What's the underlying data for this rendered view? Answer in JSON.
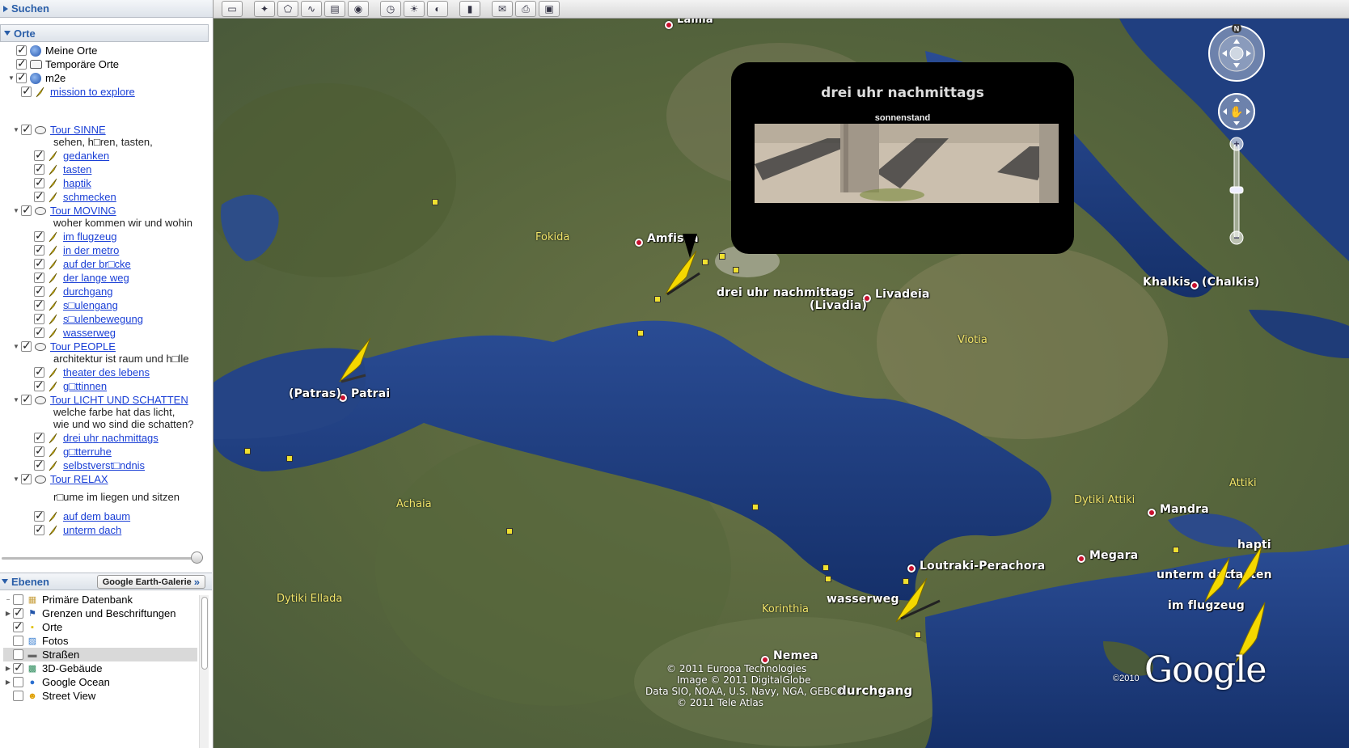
{
  "sidebar": {
    "search_header": "Suchen",
    "places_header": "Orte",
    "places": [
      {
        "label": "Meine Orte",
        "type": "globe",
        "level": 0,
        "link": false,
        "expander": ""
      },
      {
        "label": "Temporäre Orte",
        "type": "folder",
        "level": 0,
        "link": false,
        "expander": ""
      },
      {
        "label": "m2e",
        "type": "globe",
        "level": 0,
        "link": false,
        "expander": "▼"
      },
      {
        "label": "mission to explore",
        "type": "pin",
        "level": 1,
        "link": true,
        "expander": ""
      },
      {
        "label": "Tour SINNE",
        "type": "tour",
        "level": 1,
        "link": true,
        "expander": "▼"
      },
      {
        "label": "sehen, h□ren, tasten,",
        "type": "desc",
        "level": 1,
        "link": false,
        "expander": ""
      },
      {
        "label": "gedanken",
        "type": "pin",
        "level": 2,
        "link": true,
        "expander": ""
      },
      {
        "label": "tasten",
        "type": "pin",
        "level": 2,
        "link": true,
        "expander": ""
      },
      {
        "label": "haptik",
        "type": "pin",
        "level": 2,
        "link": true,
        "expander": ""
      },
      {
        "label": "schmecken",
        "type": "pin",
        "level": 2,
        "link": true,
        "expander": ""
      },
      {
        "label": "Tour MOVING",
        "type": "tour",
        "level": 1,
        "link": true,
        "expander": "▼"
      },
      {
        "label": "woher kommen wir und wohin",
        "type": "desc",
        "level": 1,
        "link": false,
        "expander": ""
      },
      {
        "label": "im flugzeug",
        "type": "pin",
        "level": 2,
        "link": true,
        "expander": ""
      },
      {
        "label": "in der metro",
        "type": "pin",
        "level": 2,
        "link": true,
        "expander": ""
      },
      {
        "label": "auf der br□cke",
        "type": "pin",
        "level": 2,
        "link": true,
        "expander": ""
      },
      {
        "label": "der lange weg",
        "type": "pin",
        "level": 2,
        "link": true,
        "expander": ""
      },
      {
        "label": "durchgang",
        "type": "pin",
        "level": 2,
        "link": true,
        "expander": ""
      },
      {
        "label": "s□ulengang",
        "type": "pin",
        "level": 2,
        "link": true,
        "expander": ""
      },
      {
        "label": "s□ulenbewegung",
        "type": "pin",
        "level": 2,
        "link": true,
        "expander": ""
      },
      {
        "label": "wasserweg",
        "type": "pin",
        "level": 2,
        "link": true,
        "expander": ""
      },
      {
        "label": "Tour PEOPLE",
        "type": "tour",
        "level": 1,
        "link": true,
        "expander": "▼"
      },
      {
        "label": "architektur ist raum und h□lle",
        "type": "desc",
        "level": 1,
        "link": false,
        "expander": ""
      },
      {
        "label": "theater des lebens",
        "type": "pin",
        "level": 2,
        "link": true,
        "expander": ""
      },
      {
        "label": "g□ttinnen",
        "type": "pin",
        "level": 2,
        "link": true,
        "expander": ""
      },
      {
        "label": "Tour LICHT UND SCHATTEN",
        "type": "tour",
        "level": 1,
        "link": true,
        "expander": "▼"
      },
      {
        "label": "welche farbe hat das licht,",
        "type": "desc",
        "level": 1,
        "link": false,
        "expander": ""
      },
      {
        "label": "wie und wo sind die schatten?",
        "type": "desc",
        "level": 1,
        "link": false,
        "expander": ""
      },
      {
        "label": "drei uhr nachmittags",
        "type": "pin",
        "level": 2,
        "link": true,
        "expander": ""
      },
      {
        "label": "g□tterruhe",
        "type": "pin",
        "level": 2,
        "link": true,
        "expander": ""
      },
      {
        "label": "selbstverst□ndnis",
        "type": "pin",
        "level": 2,
        "link": true,
        "expander": ""
      },
      {
        "label": "Tour RELAX",
        "type": "tour",
        "level": 1,
        "link": true,
        "expander": "▼"
      },
      {
        "label": "r□ume im liegen und sitzen",
        "type": "desc",
        "level": 1,
        "link": false,
        "expander": ""
      },
      {
        "label": "auf dem baum",
        "type": "pin",
        "level": 2,
        "link": true,
        "expander": ""
      },
      {
        "label": "unterm dach",
        "type": "pin",
        "level": 2,
        "link": true,
        "expander": ""
      }
    ],
    "layers_header": "Ebenen",
    "gallery_button": "Google Earth-Galerie",
    "gallery_chevrons": "»",
    "layers": [
      {
        "label": "Primäre Datenbank",
        "checked": false,
        "expander": "−"
      },
      {
        "label": "Grenzen und Beschriftungen",
        "checked": true,
        "expander": "▶"
      },
      {
        "label": "Orte",
        "checked": true,
        "expander": ""
      },
      {
        "label": "Fotos",
        "checked": false,
        "expander": ""
      },
      {
        "label": "Straßen",
        "checked": false,
        "expander": ""
      },
      {
        "label": "3D-Gebäude",
        "checked": true,
        "expander": "▶"
      },
      {
        "label": "Google Ocean",
        "checked": false,
        "expander": "▶"
      },
      {
        "label": "Street View",
        "checked": false,
        "expander": ""
      }
    ]
  },
  "toolbar": {
    "buttons": [
      "sidebar-toggle-icon",
      "placemark-icon",
      "polygon-icon",
      "path-icon",
      "image-overlay-icon",
      "record-tour-icon",
      "historical-imagery-icon",
      "sunlight-icon",
      "planets-icon",
      "ruler-icon",
      "email-icon",
      "print-icon",
      "save-image-icon"
    ],
    "glyphs": [
      "▭",
      "✦",
      "⬠",
      "∿",
      "▤",
      "◉",
      "◷",
      "☀",
      "◐",
      "▮",
      "✉",
      "⎙",
      "▣"
    ]
  },
  "balloon": {
    "title": "drei uhr nachmittags",
    "subtitle": "sonnenstand"
  },
  "map": {
    "place_labels": [
      {
        "text": "Lamia"
      },
      {
        "text": "Amfissa"
      },
      {
        "text": "drei uhr nachmittags"
      },
      {
        "text": "(Livadia)"
      },
      {
        "text": "Livadeia"
      },
      {
        "text": "Khalkis"
      },
      {
        "text": "(Chalkis)"
      },
      {
        "text": "(Patras)"
      },
      {
        "text": "Patrai"
      },
      {
        "text": "Loutraki-Perachora"
      },
      {
        "text": "Megara"
      },
      {
        "text": "Mandra"
      },
      {
        "text": "wasserweg"
      },
      {
        "text": "Nemea"
      },
      {
        "text": "durchgang"
      },
      {
        "text": "unterm dach"
      },
      {
        "text": "tasten"
      },
      {
        "text": "im flugzeug"
      },
      {
        "text": "hapti"
      }
    ],
    "region_labels": [
      "Fokida",
      "Viotia",
      "Achaia",
      "Dytiki Attiki",
      "Attiki",
      "Dytiki Ellada",
      "Korinthia"
    ],
    "copyright_lines": [
      "© 2011 Europa Technologies",
      "Image © 2011 DigitalGlobe",
      "Data SIO, NOAA, U.S. Navy, NGA, GEBCO",
      "© 2011 Tele Atlas"
    ],
    "logo_year": "©2010",
    "logo_text": "Google",
    "compass_north": "N"
  },
  "colors": {
    "link": "#1a3fd6",
    "header_text": "#2a5ea8",
    "sea": "#1b3a7a",
    "land": "#5a6840",
    "city_dot": "#c8102e",
    "marker": "#f5d800"
  }
}
